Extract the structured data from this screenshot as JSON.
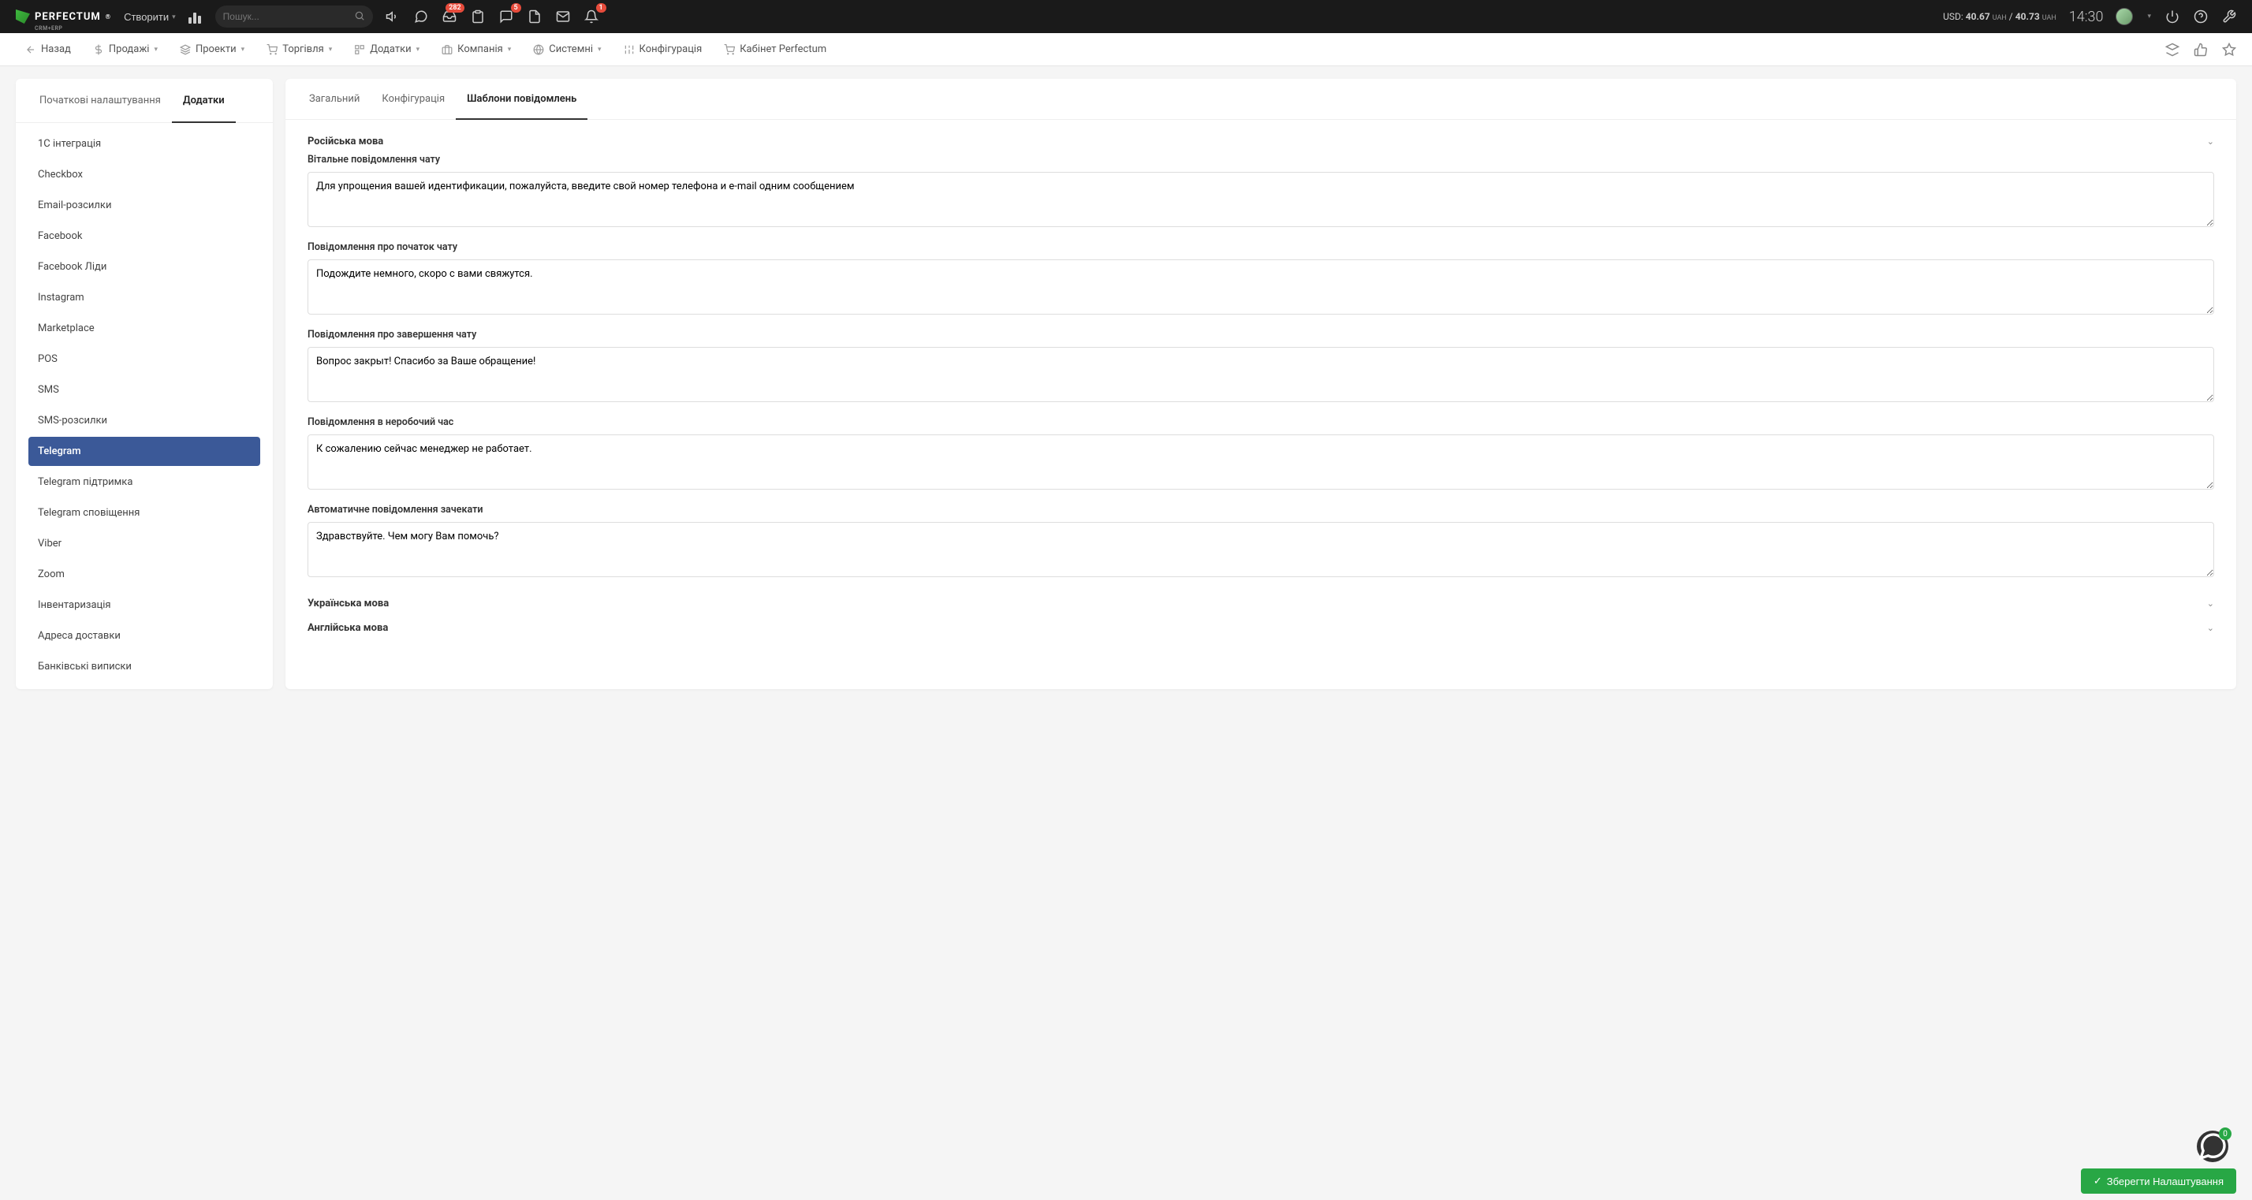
{
  "topbar": {
    "logo_text": "PERFECTUM",
    "logo_sub": "CRM+ERP",
    "create_label": "Створити",
    "search_placeholder": "Пошук...",
    "inbox_badge": "282",
    "messages_badge": "5",
    "bell_badge": "1",
    "currency_usd_label": "USD:",
    "currency_usd_val": "40.67",
    "currency_uah1": "UAH",
    "currency_sep": " / ",
    "currency_val2": "40.73",
    "currency_uah2": "UAH",
    "time": "14:30"
  },
  "nav": {
    "back": "Назад",
    "sales": "Продажі",
    "projects": "Проекти",
    "trade": "Торгівля",
    "addons": "Додатки",
    "company": "Компанія",
    "system": "Системні",
    "config": "Конфігурація",
    "cabinet": "Кабінет Perfectum"
  },
  "sidebar": {
    "tab_initial": "Початкові налаштування",
    "tab_addons": "Додатки",
    "items": [
      "1С інтеграція",
      "Checkbox",
      "Email-розсилки",
      "Facebook",
      "Facebook Ліди",
      "Instagram",
      "Marketplace",
      "POS",
      "SMS",
      "SMS-розсилки",
      "Telegram",
      "Telegram підтримка",
      "Telegram сповіщення",
      "Viber",
      "Zoom",
      "Інвентаризація",
      "Адреса доставки",
      "Банківські виписки"
    ],
    "active_index": 10
  },
  "main": {
    "tab_general": "Загальний",
    "tab_config": "Конфігурація",
    "tab_templates": "Шаблони повідомлень",
    "section_ru": "Російська мова",
    "section_uk": "Українська мова",
    "section_en": "Англійська мова",
    "fields": {
      "welcome_label": "Вітальне повідомлення чату",
      "welcome_value": "Для упрощения вашей идентификации, пожалуйста, введите свой номер телефона и e-mail одним сообщением",
      "start_label": "Повідомлення про початок чату",
      "start_value": "Подождите немного, скоро с вами свяжутся.",
      "end_label": "Повідомлення про завершення чату",
      "end_value": "Вопрос закрыт! Спасибо за Ваше обращение!",
      "offhours_label": "Повідомлення в неробочий час",
      "offhours_value": "К сожалению сейчас менеджер не работает.",
      "wait_label": "Автоматичне повідомлення зачекати",
      "wait_value": "Здравствуйте. Чем могу Вам помочь?"
    }
  },
  "save_label": "Зберегти Налаштування",
  "chat_badge": "0"
}
